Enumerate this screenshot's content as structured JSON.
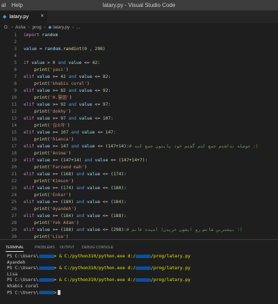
{
  "titlebar": {
    "menu": [
      "al",
      "Help"
    ],
    "title": "latary.py - Visual Studio Code"
  },
  "tab": {
    "name": "latary.py",
    "close": "×"
  },
  "breadcrumb": {
    "items": [
      "D:",
      "Asha",
      "prog",
      "latary.py",
      "..."
    ]
  },
  "code_lines": [
    {
      "n": "1",
      "parts": [
        [
          "kw",
          "import"
        ],
        [
          "p",
          " "
        ],
        [
          "var",
          "random"
        ]
      ]
    },
    {
      "n": "2",
      "parts": []
    },
    {
      "n": "3",
      "parts": [
        [
          "var",
          "value"
        ],
        [
          "p",
          " = "
        ],
        [
          "var",
          "random"
        ],
        [
          "p",
          "."
        ],
        [
          "fn",
          "randint"
        ],
        [
          "p",
          "("
        ],
        [
          "num",
          "0"
        ],
        [
          "p",
          " , "
        ],
        [
          "num",
          "298"
        ],
        [
          "p",
          ")"
        ]
      ]
    },
    {
      "n": "4",
      "parts": []
    },
    {
      "n": "5",
      "parts": [
        [
          "kw",
          "if"
        ],
        [
          "p",
          " "
        ],
        [
          "var",
          "value"
        ],
        [
          "p",
          " > "
        ],
        [
          "num",
          "0"
        ],
        [
          "p",
          " "
        ],
        [
          "kw2",
          "and"
        ],
        [
          "p",
          " "
        ],
        [
          "var",
          "value"
        ],
        [
          "p",
          " <= "
        ],
        [
          "num",
          "42"
        ],
        [
          "p",
          ":"
        ]
      ]
    },
    {
      "n": "6",
      "parts": [
        [
          "p",
          "    "
        ],
        [
          "fn",
          "print"
        ],
        [
          "p",
          "("
        ],
        [
          "str",
          "'yasi'"
        ],
        [
          "p",
          ")"
        ]
      ]
    },
    {
      "n": "7",
      "parts": [
        [
          "kw",
          "elif"
        ],
        [
          "p",
          " "
        ],
        [
          "var",
          "value"
        ],
        [
          "p",
          " >= "
        ],
        [
          "num",
          "42"
        ],
        [
          "p",
          " "
        ],
        [
          "kw2",
          "and"
        ],
        [
          "p",
          " "
        ],
        [
          "var",
          "value"
        ],
        [
          "p",
          " <= "
        ],
        [
          "num",
          "82"
        ],
        [
          "p",
          ":"
        ]
      ]
    },
    {
      "n": "8",
      "parts": [
        [
          "p",
          "    "
        ],
        [
          "fn",
          "print"
        ],
        [
          "p",
          "("
        ],
        [
          "str",
          "'khabis coral'"
        ],
        [
          "p",
          ")"
        ]
      ]
    },
    {
      "n": "9",
      "parts": [
        [
          "kw",
          "elif"
        ],
        [
          "p",
          " "
        ],
        [
          "var",
          "value"
        ],
        [
          "p",
          " >= "
        ],
        [
          "num",
          "82"
        ],
        [
          "p",
          " "
        ],
        [
          "kw2",
          "and"
        ],
        [
          "p",
          " "
        ],
        [
          "var",
          "value"
        ],
        [
          "p",
          " <= "
        ],
        [
          "num",
          "92"
        ],
        [
          "p",
          ":"
        ]
      ]
    },
    {
      "n": "10",
      "parts": [
        [
          "p",
          "    "
        ],
        [
          "fn",
          "print"
        ],
        [
          "p",
          "("
        ],
        [
          "str",
          "'H.慧田'"
        ],
        [
          "p",
          ")"
        ]
      ]
    },
    {
      "n": "11",
      "parts": [
        [
          "kw",
          "elif"
        ],
        [
          "p",
          " "
        ],
        [
          "var",
          "value"
        ],
        [
          "p",
          " >= "
        ],
        [
          "num",
          "92"
        ],
        [
          "p",
          " "
        ],
        [
          "kw2",
          "and"
        ],
        [
          "p",
          " "
        ],
        [
          "var",
          "value"
        ],
        [
          "p",
          " <= "
        ],
        [
          "num",
          "97"
        ],
        [
          "p",
          ":"
        ]
      ]
    },
    {
      "n": "12",
      "parts": [
        [
          "p",
          "    "
        ],
        [
          "fn",
          "print"
        ],
        [
          "p",
          "("
        ],
        [
          "str",
          "'dokhy'"
        ],
        [
          "p",
          ")"
        ]
      ]
    },
    {
      "n": "13",
      "parts": [
        [
          "kw",
          "elif"
        ],
        [
          "p",
          " "
        ],
        [
          "var",
          "value"
        ],
        [
          "p",
          " >= "
        ],
        [
          "num",
          "97"
        ],
        [
          "p",
          " "
        ],
        [
          "kw2",
          "and"
        ],
        [
          "p",
          " "
        ],
        [
          "var",
          "value"
        ],
        [
          "p",
          " <= "
        ],
        [
          "num",
          "107"
        ],
        [
          "p",
          ":"
        ]
      ]
    },
    {
      "n": "14",
      "parts": [
        [
          "p",
          "    "
        ],
        [
          "fn",
          "print"
        ],
        [
          "p",
          "("
        ],
        [
          "str",
          "'김소아'"
        ],
        [
          "p",
          ")"
        ]
      ]
    },
    {
      "n": "15",
      "parts": [
        [
          "kw",
          "elif"
        ],
        [
          "p",
          " "
        ],
        [
          "var",
          "value"
        ],
        [
          "p",
          " >= "
        ],
        [
          "num",
          "107"
        ],
        [
          "p",
          " "
        ],
        [
          "kw2",
          "and"
        ],
        [
          "p",
          " "
        ],
        [
          "var",
          "value"
        ],
        [
          "p",
          " <= "
        ],
        [
          "num",
          "147"
        ],
        [
          "p",
          ":"
        ]
      ]
    },
    {
      "n": "16",
      "parts": [
        [
          "p",
          "    "
        ],
        [
          "fn",
          "print"
        ],
        [
          "p",
          "("
        ],
        [
          "str",
          "'hianca'"
        ],
        [
          "p",
          ")"
        ]
      ]
    },
    {
      "n": "17",
      "parts": [
        [
          "kw",
          "elif"
        ],
        [
          "p",
          " "
        ],
        [
          "var",
          "value"
        ],
        [
          "p",
          " >= "
        ],
        [
          "num",
          "147"
        ],
        [
          "p",
          " "
        ],
        [
          "kw2",
          "and"
        ],
        [
          "p",
          " "
        ],
        [
          "var",
          "value"
        ],
        [
          "p",
          " <= "
        ],
        [
          "p",
          "("
        ],
        [
          "num",
          "147"
        ],
        [
          "p",
          "+"
        ],
        [
          "num",
          "14"
        ],
        [
          "p",
          "):"
        ],
        [
          "cm",
          "# حوصله نداشتم جمع کنم گفتم خود پایتون جمع کنه :)"
        ]
      ]
    },
    {
      "n": "18",
      "parts": [
        [
          "p",
          "    "
        ],
        [
          "fn",
          "print"
        ],
        [
          "p",
          "("
        ],
        [
          "str",
          "'Anima'"
        ],
        [
          "p",
          ")"
        ]
      ]
    },
    {
      "n": "19",
      "parts": [
        [
          "kw",
          "elif"
        ],
        [
          "p",
          " "
        ],
        [
          "var",
          "value"
        ],
        [
          "p",
          " >= "
        ],
        [
          "p",
          "("
        ],
        [
          "num",
          "147"
        ],
        [
          "p",
          "+"
        ],
        [
          "num",
          "14"
        ],
        [
          "p",
          ") "
        ],
        [
          "kw2",
          "and"
        ],
        [
          "p",
          " "
        ],
        [
          "var",
          "value"
        ],
        [
          "p",
          " <= "
        ],
        [
          "p",
          "("
        ],
        [
          "num",
          "147"
        ],
        [
          "p",
          "+"
        ],
        [
          "num",
          "14"
        ],
        [
          "p",
          "+"
        ],
        [
          "num",
          "7"
        ],
        [
          "p",
          "):"
        ]
      ]
    },
    {
      "n": "20",
      "parts": [
        [
          "p",
          "    "
        ],
        [
          "fn",
          "print"
        ],
        [
          "p",
          "("
        ],
        [
          "str",
          "'Farzand mah'"
        ],
        [
          "p",
          ")"
        ]
      ]
    },
    {
      "n": "21",
      "parts": [
        [
          "kw",
          "elif"
        ],
        [
          "p",
          " "
        ],
        [
          "var",
          "value"
        ],
        [
          "p",
          " >= "
        ],
        [
          "p",
          "("
        ],
        [
          "num",
          "168"
        ],
        [
          "p",
          ") "
        ],
        [
          "kw2",
          "and"
        ],
        [
          "p",
          " "
        ],
        [
          "var",
          "value"
        ],
        [
          "p",
          " <= "
        ],
        [
          "p",
          "("
        ],
        [
          "num",
          "174"
        ],
        [
          "p",
          "):"
        ]
      ]
    },
    {
      "n": "22",
      "parts": [
        [
          "p",
          "    "
        ],
        [
          "fn",
          "print"
        ],
        [
          "p",
          "("
        ],
        [
          "str",
          "'Kimson'"
        ],
        [
          "p",
          ")"
        ]
      ]
    },
    {
      "n": "23",
      "parts": [
        [
          "kw",
          "elif"
        ],
        [
          "p",
          " "
        ],
        [
          "var",
          "value"
        ],
        [
          "p",
          " >= "
        ],
        [
          "p",
          "("
        ],
        [
          "num",
          "174"
        ],
        [
          "p",
          ") "
        ],
        [
          "kw2",
          "and"
        ],
        [
          "p",
          " "
        ],
        [
          "var",
          "value"
        ],
        [
          "p",
          " <= "
        ],
        [
          "p",
          "("
        ],
        [
          "num",
          "180"
        ],
        [
          "p",
          "):"
        ]
      ]
    },
    {
      "n": "24",
      "parts": [
        [
          "p",
          "    "
        ],
        [
          "fn",
          "print"
        ],
        [
          "p",
          "("
        ],
        [
          "str",
          "'Enkar'"
        ],
        [
          "p",
          ")"
        ]
      ]
    },
    {
      "n": "25",
      "parts": [
        [
          "kw",
          "elif"
        ],
        [
          "p",
          " "
        ],
        [
          "var",
          "value"
        ],
        [
          "p",
          " >= "
        ],
        [
          "p",
          "("
        ],
        [
          "num",
          "180"
        ],
        [
          "p",
          ") "
        ],
        [
          "kw2",
          "and"
        ],
        [
          "p",
          " "
        ],
        [
          "var",
          "value"
        ],
        [
          "p",
          " <= "
        ],
        [
          "p",
          "("
        ],
        [
          "num",
          "184"
        ],
        [
          "p",
          "):"
        ]
      ]
    },
    {
      "n": "26",
      "parts": [
        [
          "p",
          "    "
        ],
        [
          "fn",
          "print"
        ],
        [
          "p",
          "("
        ],
        [
          "str",
          "'Ayandeh'"
        ],
        [
          "p",
          ")"
        ]
      ]
    },
    {
      "n": "27",
      "parts": [
        [
          "kw",
          "elif"
        ],
        [
          "p",
          " "
        ],
        [
          "var",
          "value"
        ],
        [
          "p",
          " >= "
        ],
        [
          "p",
          "("
        ],
        [
          "num",
          "184"
        ],
        [
          "p",
          ") "
        ],
        [
          "kw2",
          "and"
        ],
        [
          "p",
          " "
        ],
        [
          "var",
          "value"
        ],
        [
          "p",
          " <= "
        ],
        [
          "p",
          "("
        ],
        [
          "num",
          "188"
        ],
        [
          "p",
          "):"
        ]
      ]
    },
    {
      "n": "28",
      "parts": [
        [
          "p",
          "    "
        ],
        [
          "fn",
          "print"
        ],
        [
          "p",
          "("
        ],
        [
          "str",
          "'Yek Adam'"
        ],
        [
          "p",
          ")"
        ]
      ]
    },
    {
      "n": "29",
      "parts": [
        [
          "kw",
          "elif"
        ],
        [
          "p",
          " "
        ],
        [
          "var",
          "value"
        ],
        [
          "p",
          " >= "
        ],
        [
          "p",
          "("
        ],
        [
          "num",
          "188"
        ],
        [
          "p",
          ") "
        ],
        [
          "kw2",
          "and"
        ],
        [
          "p",
          " "
        ],
        [
          "var",
          "value"
        ],
        [
          "p",
          " <= "
        ],
        [
          "p",
          "("
        ],
        [
          "num",
          "298"
        ],
        [
          "p",
          "):"
        ],
        [
          "cm",
          "# بیشترین شانس رو ایشون خریدن! امیده قانم :)"
        ]
      ]
    },
    {
      "n": "30",
      "parts": [
        [
          "p",
          "    "
        ],
        [
          "fn",
          "print"
        ],
        [
          "p",
          "("
        ],
        [
          "str",
          "'Lisa'"
        ],
        [
          "p",
          ")"
        ]
      ]
    }
  ],
  "panel": {
    "tabs": [
      "TERMINAL",
      "PROBLEMS",
      "OUTPUT",
      "DEBUG CONSOLE"
    ],
    "terminal": [
      {
        "prompt": "PS C:\\Users\\",
        "cmd": "> & C:/python310/python.exe d:/",
        "path": "/prog/latary.py"
      },
      {
        "out": "Ayandeh"
      },
      {
        "prompt": "PS C:\\Users\\",
        "cmd": "> & C:/python310/python.exe d:/",
        "path": "/prog/latary.py"
      },
      {
        "out": "Lisa"
      },
      {
        "prompt": "PS C:\\Users\\",
        "cmd": "> & C:/python310/python.exe d:/",
        "path": "/prog/latary.py"
      },
      {
        "out": "khabis coral"
      },
      {
        "prompt": "PS C:\\Users\\",
        "cmd": ">",
        "path": "",
        "cursor": true
      }
    ]
  }
}
